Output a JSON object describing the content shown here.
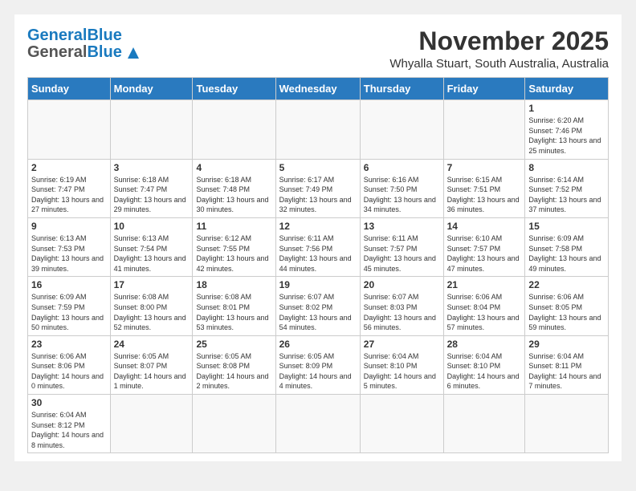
{
  "header": {
    "logo_general": "General",
    "logo_blue": "Blue",
    "month": "November 2025",
    "location": "Whyalla Stuart, South Australia, Australia"
  },
  "weekdays": [
    "Sunday",
    "Monday",
    "Tuesday",
    "Wednesday",
    "Thursday",
    "Friday",
    "Saturday"
  ],
  "weeks": [
    [
      {
        "day": "",
        "info": ""
      },
      {
        "day": "",
        "info": ""
      },
      {
        "day": "",
        "info": ""
      },
      {
        "day": "",
        "info": ""
      },
      {
        "day": "",
        "info": ""
      },
      {
        "day": "",
        "info": ""
      },
      {
        "day": "1",
        "info": "Sunrise: 6:20 AM\nSunset: 7:46 PM\nDaylight: 13 hours and 25 minutes."
      }
    ],
    [
      {
        "day": "2",
        "info": "Sunrise: 6:19 AM\nSunset: 7:47 PM\nDaylight: 13 hours and 27 minutes."
      },
      {
        "day": "3",
        "info": "Sunrise: 6:18 AM\nSunset: 7:47 PM\nDaylight: 13 hours and 29 minutes."
      },
      {
        "day": "4",
        "info": "Sunrise: 6:18 AM\nSunset: 7:48 PM\nDaylight: 13 hours and 30 minutes."
      },
      {
        "day": "5",
        "info": "Sunrise: 6:17 AM\nSunset: 7:49 PM\nDaylight: 13 hours and 32 minutes."
      },
      {
        "day": "6",
        "info": "Sunrise: 6:16 AM\nSunset: 7:50 PM\nDaylight: 13 hours and 34 minutes."
      },
      {
        "day": "7",
        "info": "Sunrise: 6:15 AM\nSunset: 7:51 PM\nDaylight: 13 hours and 36 minutes."
      },
      {
        "day": "8",
        "info": "Sunrise: 6:14 AM\nSunset: 7:52 PM\nDaylight: 13 hours and 37 minutes."
      }
    ],
    [
      {
        "day": "9",
        "info": "Sunrise: 6:13 AM\nSunset: 7:53 PM\nDaylight: 13 hours and 39 minutes."
      },
      {
        "day": "10",
        "info": "Sunrise: 6:13 AM\nSunset: 7:54 PM\nDaylight: 13 hours and 41 minutes."
      },
      {
        "day": "11",
        "info": "Sunrise: 6:12 AM\nSunset: 7:55 PM\nDaylight: 13 hours and 42 minutes."
      },
      {
        "day": "12",
        "info": "Sunrise: 6:11 AM\nSunset: 7:56 PM\nDaylight: 13 hours and 44 minutes."
      },
      {
        "day": "13",
        "info": "Sunrise: 6:11 AM\nSunset: 7:57 PM\nDaylight: 13 hours and 45 minutes."
      },
      {
        "day": "14",
        "info": "Sunrise: 6:10 AM\nSunset: 7:57 PM\nDaylight: 13 hours and 47 minutes."
      },
      {
        "day": "15",
        "info": "Sunrise: 6:09 AM\nSunset: 7:58 PM\nDaylight: 13 hours and 49 minutes."
      }
    ],
    [
      {
        "day": "16",
        "info": "Sunrise: 6:09 AM\nSunset: 7:59 PM\nDaylight: 13 hours and 50 minutes."
      },
      {
        "day": "17",
        "info": "Sunrise: 6:08 AM\nSunset: 8:00 PM\nDaylight: 13 hours and 52 minutes."
      },
      {
        "day": "18",
        "info": "Sunrise: 6:08 AM\nSunset: 8:01 PM\nDaylight: 13 hours and 53 minutes."
      },
      {
        "day": "19",
        "info": "Sunrise: 6:07 AM\nSunset: 8:02 PM\nDaylight: 13 hours and 54 minutes."
      },
      {
        "day": "20",
        "info": "Sunrise: 6:07 AM\nSunset: 8:03 PM\nDaylight: 13 hours and 56 minutes."
      },
      {
        "day": "21",
        "info": "Sunrise: 6:06 AM\nSunset: 8:04 PM\nDaylight: 13 hours and 57 minutes."
      },
      {
        "day": "22",
        "info": "Sunrise: 6:06 AM\nSunset: 8:05 PM\nDaylight: 13 hours and 59 minutes."
      }
    ],
    [
      {
        "day": "23",
        "info": "Sunrise: 6:06 AM\nSunset: 8:06 PM\nDaylight: 14 hours and 0 minutes."
      },
      {
        "day": "24",
        "info": "Sunrise: 6:05 AM\nSunset: 8:07 PM\nDaylight: 14 hours and 1 minute."
      },
      {
        "day": "25",
        "info": "Sunrise: 6:05 AM\nSunset: 8:08 PM\nDaylight: 14 hours and 2 minutes."
      },
      {
        "day": "26",
        "info": "Sunrise: 6:05 AM\nSunset: 8:09 PM\nDaylight: 14 hours and 4 minutes."
      },
      {
        "day": "27",
        "info": "Sunrise: 6:04 AM\nSunset: 8:10 PM\nDaylight: 14 hours and 5 minutes."
      },
      {
        "day": "28",
        "info": "Sunrise: 6:04 AM\nSunset: 8:10 PM\nDaylight: 14 hours and 6 minutes."
      },
      {
        "day": "29",
        "info": "Sunrise: 6:04 AM\nSunset: 8:11 PM\nDaylight: 14 hours and 7 minutes."
      }
    ],
    [
      {
        "day": "30",
        "info": "Sunrise: 6:04 AM\nSunset: 8:12 PM\nDaylight: 14 hours and 8 minutes."
      },
      {
        "day": "",
        "info": ""
      },
      {
        "day": "",
        "info": ""
      },
      {
        "day": "",
        "info": ""
      },
      {
        "day": "",
        "info": ""
      },
      {
        "day": "",
        "info": ""
      },
      {
        "day": "",
        "info": ""
      }
    ]
  ]
}
